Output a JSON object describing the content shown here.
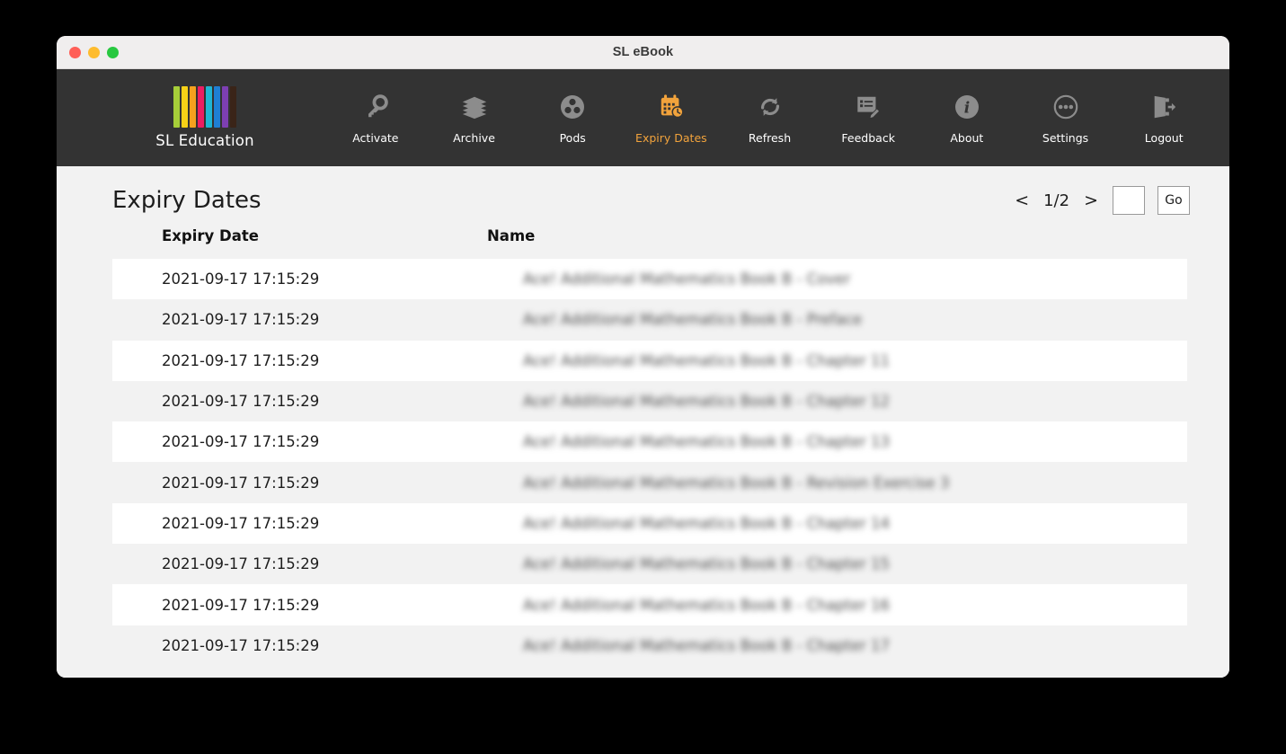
{
  "window": {
    "title": "SL eBook",
    "traffic_lights": [
      {
        "name": "close",
        "color": "#ff5f57"
      },
      {
        "name": "minimize",
        "color": "#febc2e"
      },
      {
        "name": "maximize",
        "color": "#28c840"
      }
    ]
  },
  "brand": {
    "name": "SL Education",
    "bar_colors": [
      "#a6ce39",
      "#f7d117",
      "#f5a11e",
      "#ec1d62",
      "#1fb5d4",
      "#1f7fd4",
      "#7d3fb3",
      "#3a2418"
    ]
  },
  "nav": {
    "active_color": "#f2a33c",
    "items": [
      {
        "label": "Activate",
        "icon": "key-icon",
        "active": false
      },
      {
        "label": "Archive",
        "icon": "books-icon",
        "active": false
      },
      {
        "label": "Pods",
        "icon": "pods-icon",
        "active": false
      },
      {
        "label": "Expiry Dates",
        "icon": "calendar-clock-icon",
        "active": true
      },
      {
        "label": "Refresh",
        "icon": "refresh-icon",
        "active": false
      },
      {
        "label": "Feedback",
        "icon": "feedback-icon",
        "active": false
      },
      {
        "label": "About",
        "icon": "info-icon",
        "active": false
      },
      {
        "label": "Settings",
        "icon": "ellipsis-icon",
        "active": false
      },
      {
        "label": "Logout",
        "icon": "logout-icon",
        "active": false
      }
    ]
  },
  "page": {
    "title": "Expiry Dates"
  },
  "pagination": {
    "prev_label": "<",
    "next_label": ">",
    "page_indicator": "1/2",
    "current_page": 1,
    "total_pages": 2,
    "goto_value": "",
    "goto_placeholder": "",
    "go_label": "Go"
  },
  "table": {
    "columns": [
      "Expiry Date",
      "Name"
    ],
    "rows": [
      {
        "date": "2021-09-17 17:15:29",
        "name": "Ace! Additional Mathematics Book B - Cover"
      },
      {
        "date": "2021-09-17 17:15:29",
        "name": "Ace! Additional Mathematics Book B - Preface"
      },
      {
        "date": "2021-09-17 17:15:29",
        "name": "Ace! Additional Mathematics Book B - Chapter 11"
      },
      {
        "date": "2021-09-17 17:15:29",
        "name": "Ace! Additional Mathematics Book B - Chapter 12"
      },
      {
        "date": "2021-09-17 17:15:29",
        "name": "Ace! Additional Mathematics Book B - Chapter 13"
      },
      {
        "date": "2021-09-17 17:15:29",
        "name": "Ace! Additional Mathematics Book B - Revision Exercise 3"
      },
      {
        "date": "2021-09-17 17:15:29",
        "name": "Ace! Additional Mathematics Book B - Chapter 14"
      },
      {
        "date": "2021-09-17 17:15:29",
        "name": "Ace! Additional Mathematics Book B - Chapter 15"
      },
      {
        "date": "2021-09-17 17:15:29",
        "name": "Ace! Additional Mathematics Book B - Chapter 16"
      },
      {
        "date": "2021-09-17 17:15:29",
        "name": "Ace! Additional Mathematics Book B - Chapter 17"
      }
    ]
  }
}
